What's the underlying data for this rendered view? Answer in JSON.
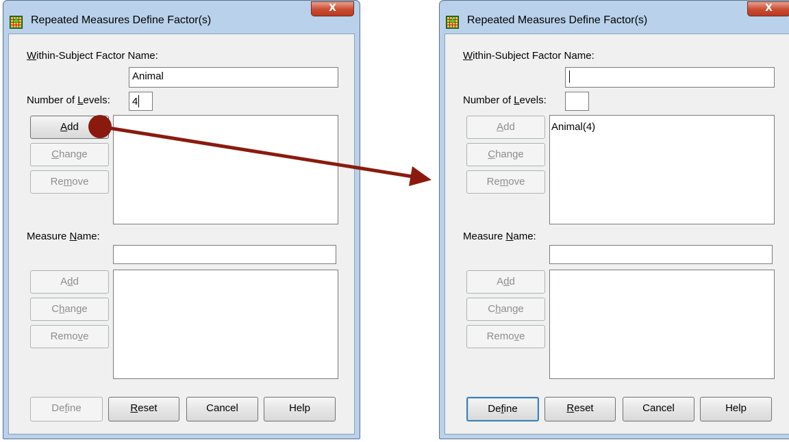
{
  "dialog_left": {
    "title": "Repeated Measures Define Factor(s)",
    "close_glyph": "X",
    "factor_name_label": {
      "pre": "",
      "accel": "W",
      "post": "ithin-Subject Factor Name:"
    },
    "factor_name_value": "Animal",
    "levels_label": {
      "pre": "Number of ",
      "accel": "L",
      "post": "evels:"
    },
    "levels_value": "4",
    "add": {
      "pre": "",
      "accel": "A",
      "post": "dd"
    },
    "change": {
      "pre": "",
      "accel": "C",
      "post": "hange"
    },
    "remove": {
      "pre": "Re",
      "accel": "m",
      "post": "ove"
    },
    "measure_label": {
      "pre": "Measure ",
      "accel": "N",
      "post": "ame:"
    },
    "measure_value": "",
    "m_add": {
      "pre": "A",
      "accel": "d",
      "post": "d"
    },
    "m_change": {
      "pre": "C",
      "accel": "h",
      "post": "ange"
    },
    "m_remove": {
      "pre": "Remo",
      "accel": "v",
      "post": "e"
    },
    "define": {
      "pre": "De",
      "accel": "f",
      "post": "ine"
    },
    "reset": {
      "pre": "",
      "accel": "R",
      "post": "eset"
    },
    "cancel": "Cancel",
    "help": "Help"
  },
  "dialog_right": {
    "title": "Repeated Measures Define Factor(s)",
    "close_glyph": "X",
    "factor_name_label": {
      "pre": "",
      "accel": "W",
      "post": "ithin-Subject Factor Name:"
    },
    "factor_name_value": "",
    "levels_label": {
      "pre": "Number of ",
      "accel": "L",
      "post": "evels:"
    },
    "levels_value": "",
    "factor_list_item": "Animal(4)",
    "add": {
      "pre": "",
      "accel": "A",
      "post": "dd"
    },
    "change": {
      "pre": "",
      "accel": "C",
      "post": "hange"
    },
    "remove": {
      "pre": "Re",
      "accel": "m",
      "post": "ove"
    },
    "measure_label": {
      "pre": "Measure ",
      "accel": "N",
      "post": "ame:"
    },
    "measure_value": "",
    "m_add": {
      "pre": "A",
      "accel": "d",
      "post": "d"
    },
    "m_change": {
      "pre": "C",
      "accel": "h",
      "post": "ange"
    },
    "m_remove": {
      "pre": "Remo",
      "accel": "v",
      "post": "e"
    },
    "define": {
      "pre": "De",
      "accel": "f",
      "post": "ine"
    },
    "reset": {
      "pre": "",
      "accel": "R",
      "post": "eset"
    },
    "cancel": "Cancel",
    "help": "Help"
  },
  "annotation_color": "#8b1a0e"
}
